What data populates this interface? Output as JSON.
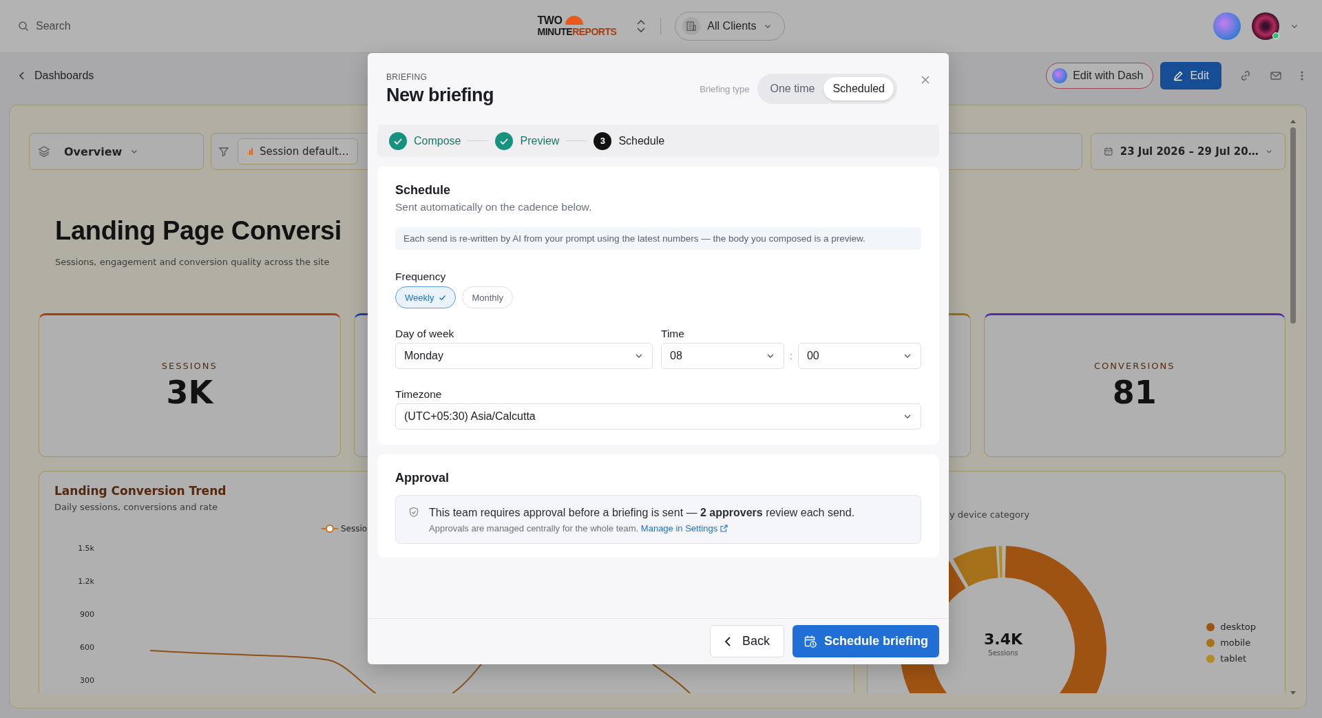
{
  "topbar": {
    "search_placeholder": "Search",
    "logo": {
      "line1": "TWO",
      "line2a": "MINUTE",
      "line2b": "REPORTS"
    },
    "client_selector": "All Clients"
  },
  "toolbar": {
    "back_link": "Dashboards",
    "buttons": [
      {
        "label": "Edit with Dash",
        "kind": "ai"
      },
      {
        "label": "Edit",
        "kind": "primary"
      }
    ]
  },
  "dashboard": {
    "view_selector": "Overview",
    "filter_chip": "Session default…",
    "date_range": "23 Jul 2026 – 29 Jul 20…",
    "title": "Landing Page Conversi",
    "subtitle": "Sessions, engagement and conversion quality across the site",
    "kpis": [
      {
        "label": "SESSIONS",
        "value": "3K",
        "color": "#a23e12"
      },
      {
        "color": "#213ba5"
      },
      {
        "color": "#9a6c12"
      },
      {
        "label": "CONVERSIONS",
        "value": "81",
        "color": "#5729a6"
      }
    ],
    "trend_chart": {
      "title": "Landing Conversion Trend",
      "subtitle": "Daily sessions, conversions and rate",
      "legend": "Sessio",
      "y_ticks": [
        "1.5k",
        "1.2k",
        "900",
        "600",
        "300"
      ]
    },
    "device_chart": {
      "subtitle": "y device category",
      "center_value": "3.4K",
      "center_label": "Sessions",
      "legend": [
        {
          "label": "desktop",
          "color": "#9f5312"
        },
        {
          "label": "mobile",
          "color": "#a5711a"
        },
        {
          "label": "tablet",
          "color": "#b08c23"
        }
      ]
    }
  },
  "modal": {
    "eyebrow": "BRIEFING",
    "title": "New briefing",
    "type_label": "Briefing type",
    "type_options": [
      {
        "label": "One time",
        "selected": false
      },
      {
        "label": "Scheduled",
        "selected": true
      }
    ],
    "steps": [
      {
        "label": "Compose",
        "kind": "done"
      },
      {
        "label": "Preview",
        "kind": "done"
      },
      {
        "label": "Schedule",
        "kind": "current",
        "number": "3"
      }
    ],
    "schedule": {
      "title": "Schedule",
      "subtitle": "Sent automatically on the cadence below.",
      "notice": "Each send is re-written by AI from your prompt using the latest numbers — the body you composed is a preview.",
      "frequency_label": "Frequency",
      "frequency_options": [
        {
          "label": "Weekly",
          "selected": true
        },
        {
          "label": "Monthly",
          "selected": false
        }
      ],
      "day_label": "Day of week",
      "day_value": "Monday",
      "time_label": "Time",
      "hour_value": "08",
      "time_separator": ":",
      "minute_value": "00",
      "timezone_label": "Timezone",
      "timezone_value": "(UTC+05:30) Asia/Calcutta"
    },
    "approval": {
      "title": "Approval",
      "message": "This team requires approval before a briefing is sent — **2 approvers** review each send.",
      "note": "Approvals are managed centrally for the whole team.",
      "link": "Manage in Settings"
    },
    "footer_buttons": [
      {
        "label": "Back",
        "kind": "back"
      },
      {
        "label": "Schedule briefing",
        "kind": "primary"
      }
    ]
  }
}
